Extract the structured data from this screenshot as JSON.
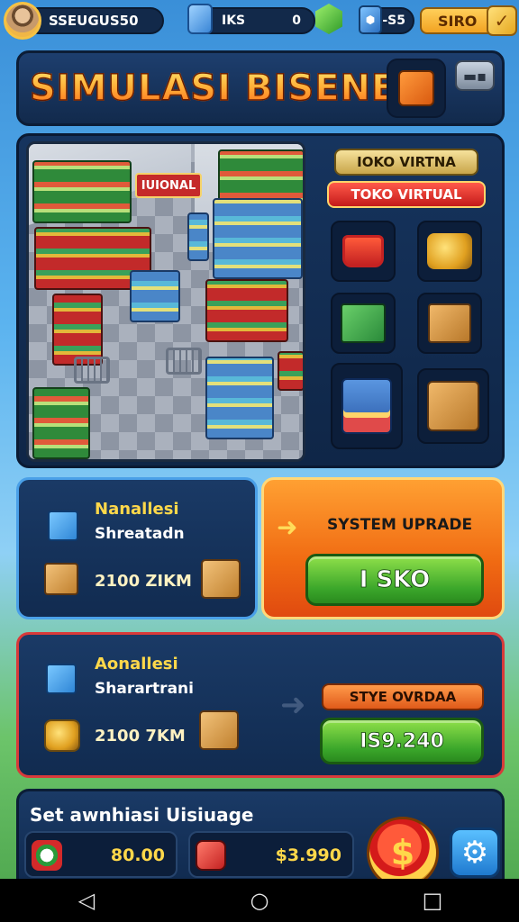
{
  "header": {
    "player_name": "SSEUGUS50",
    "resource_label": "IKS",
    "resource_value": "0",
    "xp_label": "-S5",
    "coin_label": "SIRO",
    "coin_check": "✓"
  },
  "title_panel": {
    "title": "SIMULASI BISENES"
  },
  "store": {
    "sign_text": "IUIONAL",
    "tag_gold": "IOKO VIRTNA",
    "tag_red": "TOKO VIRTUAL"
  },
  "product_1": {
    "title": "Nanallesi",
    "subtitle": "Shreatadn",
    "price": "2100 ZIKM"
  },
  "upgrade": {
    "title": "SYSTEM UPRADE",
    "button_label": "I SKO"
  },
  "product_2": {
    "title": "Aonallesi",
    "subtitle": "Sharartrani",
    "price": "2100 7KM",
    "tag": "STYE OVRDAA",
    "button_label": "IS9.240"
  },
  "status": {
    "title": "Set awnhiasi Uisiuage",
    "stat_1": "80.00",
    "stat_2": "$3.990",
    "coin_symbol": "$",
    "gear": "⚙"
  },
  "navbar": {
    "back": "◁",
    "home": "○",
    "recent": "□"
  },
  "colors": {
    "accent_gold": "#ffd84a",
    "accent_orange": "#f06a12",
    "accent_green": "#3aa62a",
    "panel_navy": "#112b50"
  }
}
